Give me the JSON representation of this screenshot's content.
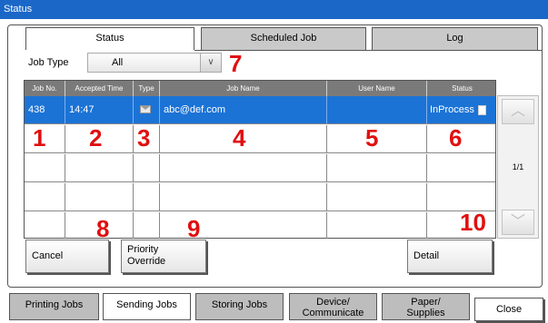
{
  "window": {
    "title": "Status"
  },
  "tabs": [
    {
      "label": "Status",
      "active": true
    },
    {
      "label": "Scheduled Job",
      "active": false
    },
    {
      "label": "Log",
      "active": false
    }
  ],
  "job_type": {
    "label": "Job Type",
    "value": "All"
  },
  "table": {
    "columns": [
      "Job No.",
      "Accepted Time",
      "Type",
      "Job Name",
      "User Name",
      "Status"
    ],
    "rows": [
      {
        "job_no": "438",
        "time": "14:47",
        "type_icon": "mail-icon",
        "job_name": "abc@def.com",
        "user_name": "",
        "status": "InProcess",
        "selected": true
      }
    ]
  },
  "scroll": {
    "up_icon": "chevron-up-icon",
    "down_icon": "chevron-down-icon",
    "page": "1/1"
  },
  "buttons": {
    "cancel": "Cancel",
    "priority_line1": "Priority",
    "priority_line2": "Override",
    "detail": "Detail"
  },
  "callouts": [
    "1",
    "2",
    "3",
    "4",
    "5",
    "6",
    "7",
    "8",
    "9",
    "10"
  ],
  "bottom_tabs": [
    {
      "line1": "Printing Jobs",
      "line2": ""
    },
    {
      "line1": "Sending Jobs",
      "line2": "",
      "active": true
    },
    {
      "line1": "Storing Jobs",
      "line2": ""
    },
    {
      "line1": "Device/",
      "line2": "Communicate"
    },
    {
      "line1": "Paper/",
      "line2": "Supplies"
    }
  ],
  "close_label": "Close",
  "colors": {
    "title_bar": "#1b67c7",
    "selected_row": "#1b73d6",
    "callout": "#e01010"
  }
}
